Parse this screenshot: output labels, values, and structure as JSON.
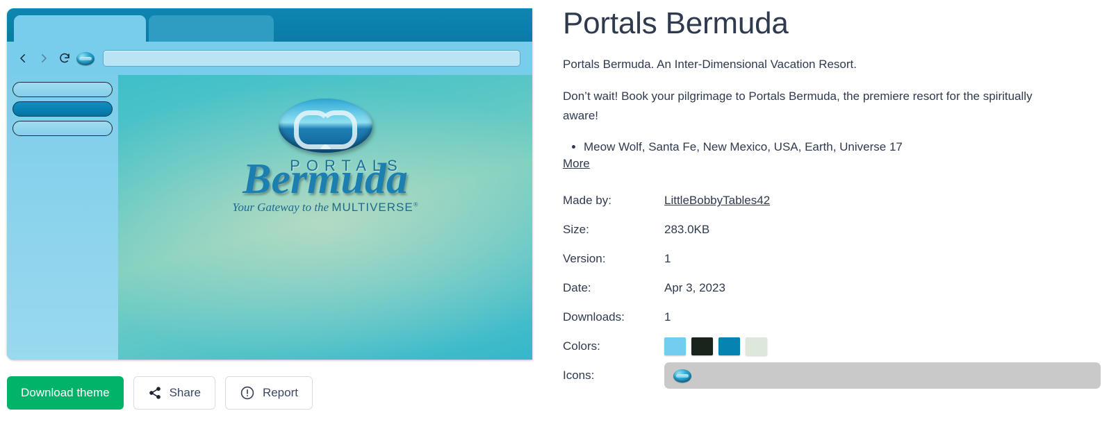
{
  "preview": {
    "browser_mock": {
      "tabs": [
        {
          "name": "active-tab",
          "state": "active"
        },
        {
          "name": "inactive-tab",
          "state": "inactive"
        }
      ],
      "toolbar": {
        "back_icon": "chevron-left-icon",
        "forward_icon": "chevron-right-icon",
        "reload_icon": "reload-icon",
        "favicon": "portals-bermuda-favicon",
        "url_value": "",
        "url_placeholder": ""
      },
      "sidebar_items": [
        {
          "name": "sidebar-pill-1",
          "state": "normal"
        },
        {
          "name": "sidebar-pill-2",
          "state": "selected"
        },
        {
          "name": "sidebar-pill-3",
          "state": "normal"
        }
      ]
    },
    "artwork": {
      "logo": "portals-bermuda-monogram",
      "word_mark": "PORTALS",
      "script_word": "Bermuda",
      "tagline_script": "Your Gateway to the ",
      "tagline_caps": "MULTIVERSE",
      "tagline_mark": "®"
    }
  },
  "actions": {
    "download_label": "Download theme",
    "share_label": "Share",
    "share_icon": "share-icon",
    "report_label": "Report",
    "report_icon": "exclamation-circle-icon"
  },
  "details": {
    "title": "Portals Bermuda",
    "description_1": "Portals Bermuda. An Inter-Dimensional Vacation Resort.",
    "description_2": "Don’t wait! Book your pilgrimage to Portals Bermuda, the premiere resort for the spiritually aware!",
    "bullets": [
      "Meow Wolf, Santa Fe, New Mexico, USA, Earth, Universe 17"
    ],
    "more_label": "More",
    "meta": {
      "made_by_label": "Made by:",
      "made_by_value": "LittleBobbyTables42",
      "size_label": "Size:",
      "size_value": "283.0KB",
      "version_label": "Version:",
      "version_value": "1",
      "date_label": "Date:",
      "date_value": "Apr 3, 2023",
      "downloads_label": "Downloads:",
      "downloads_value": "1",
      "colors_label": "Colors:",
      "colors_values": [
        "#72cdf0",
        "#1a241c",
        "#0683b0",
        "#dde7da"
      ],
      "icons_label": "Icons:",
      "icons_values": [
        "portals-bermuda-favicon"
      ]
    }
  },
  "theme": {
    "accent_green": "#00b368",
    "text_color": "#2f3a4f",
    "icons_bar_bg": "#c9c9c9"
  }
}
